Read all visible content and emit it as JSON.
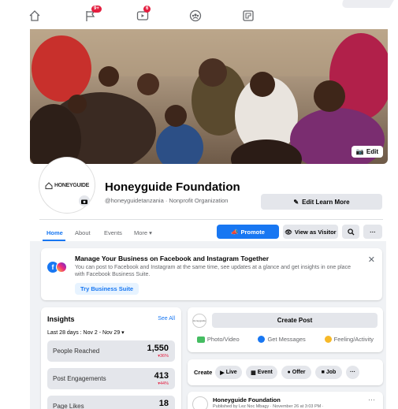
{
  "nav": {
    "notifications_badge": "9+",
    "watch_badge": "6"
  },
  "cover": {
    "edit_label": "Edit"
  },
  "profile": {
    "logo_text": "HONEYGUIDE",
    "name": "Honeyguide Foundation",
    "subtitle": "@honeyguidetanzania · Nonprofit Organization",
    "edit_learn_more": "Edit Learn More"
  },
  "tabs": [
    {
      "label": "Home",
      "active": true
    },
    {
      "label": "About"
    },
    {
      "label": "Events"
    },
    {
      "label": "More ▾"
    }
  ],
  "actions": {
    "promote": "Promote",
    "view_as_visitor": "View as Visitor",
    "more": "···"
  },
  "manage_card": {
    "title": "Manage Your Business on Facebook and Instagram Together",
    "body": "You can post to Facebook and Instagram at the same time, see updates at a glance and get insights in one place with Facebook Business Suite.",
    "button": "Try Business Suite",
    "close": "✕"
  },
  "insights": {
    "title": "Insights",
    "see_all": "See All",
    "range": "Last 28 days : Nov 2 - Nov 29 ▾",
    "rows": [
      {
        "label": "People Reached",
        "value": "1,550",
        "delta": "▾36%"
      },
      {
        "label": "Post Engagements",
        "value": "413",
        "delta": "▾44%"
      },
      {
        "label": "Page Likes",
        "value": "18",
        "delta": ""
      }
    ]
  },
  "create_post": {
    "avatar_text": "Honeyguide",
    "button": "Create Post",
    "actions": [
      "Photo/Video",
      "Get Messages",
      "Feeling/Activity"
    ]
  },
  "create_row": {
    "label": "Create",
    "pills": [
      "Live",
      "Event",
      "Offer",
      "Job",
      "···"
    ]
  },
  "post": {
    "author": "Honeyguide Foundation",
    "meta": "Published by Lez Noc Mbagy · November 26 at 3:03 PM ·",
    "more": "···"
  }
}
